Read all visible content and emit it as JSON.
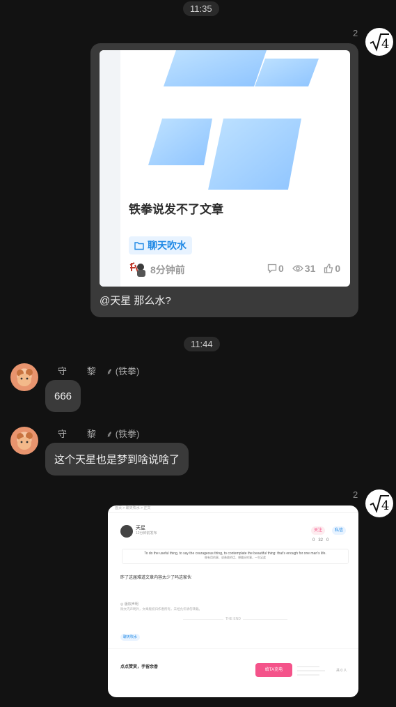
{
  "times": {
    "first": "11:35",
    "second": "11:44"
  },
  "self": {
    "unread_count": "2",
    "avatar_symbol": "√4"
  },
  "card": {
    "title": "铁拳说发不了文章",
    "tag": "聊天吹水",
    "time": "8分钟前",
    "comments": "0",
    "views": "31",
    "likes": "0"
  },
  "message_1_caption": "@天星 那么水?",
  "sender": {
    "name": "守        黎    ⸙ (铁拳)"
  },
  "message_2": "666",
  "message_3": "这个天星也是梦到啥说啥了",
  "article": {
    "breadcrumb": "首页 > 聊天吹水 > 正文",
    "author": "天星",
    "posted": "12分钟前发布",
    "follow": "关注",
    "dm": "私信",
    "stats": {
      "comments": "0",
      "views": "32",
      "likes": "0"
    },
    "quote_en": "To do the useful thing, to say the courageous thing, to contemplate the beautiful thing: that's enough for one man's life.",
    "quote_cn": "做有用的事、说勇敢的话、想美好的事，一生足矣",
    "body": "昨了这届难道文章内容太少了吗这家伙",
    "copyright_title": "◎ 版权声明",
    "copyright_text": "除文内声明外，文章版权归作者所有，未经允许请勿转载。",
    "the_end": "THE END",
    "tag": "聊天吹水",
    "reward_prompt": "点点赞赏，手留余香",
    "charge_button": "给TA充电",
    "supporters": "共 0 人"
  },
  "colors": {
    "background": "#121212",
    "bubble_self": "#3a3a3a",
    "bubble_other": "#2e2e2e",
    "accent_blue": "#1e88e5",
    "pink": "#f4538a"
  }
}
